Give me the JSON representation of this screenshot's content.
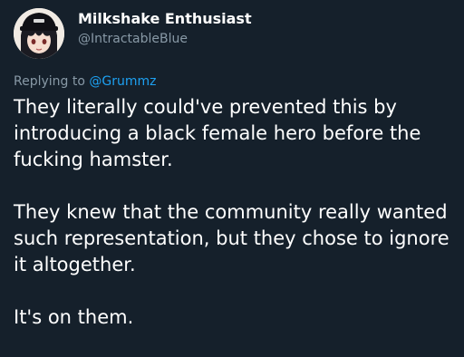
{
  "theme": {
    "background": "#15202b",
    "text": "#ffffff",
    "secondary_text": "#8899a6",
    "link": "#1da1f2"
  },
  "user": {
    "display_name": "Milkshake Enthusiast",
    "handle": "@IntractableBlue",
    "avatar_icon": "anime-avatar-black-cap"
  },
  "reply": {
    "prefix": "Replying to",
    "mention": "@Grummz"
  },
  "tweet": {
    "paragraphs": [
      {
        "lines": [
          "They literally could've prevented this by",
          "introducing a black female hero before the",
          "fucking hamster."
        ]
      },
      {
        "lines": [
          "They knew that the community really wanted",
          "such representation, but they chose to ignore",
          "it altogether."
        ]
      },
      {
        "lines": [
          "It's on them."
        ]
      }
    ]
  }
}
